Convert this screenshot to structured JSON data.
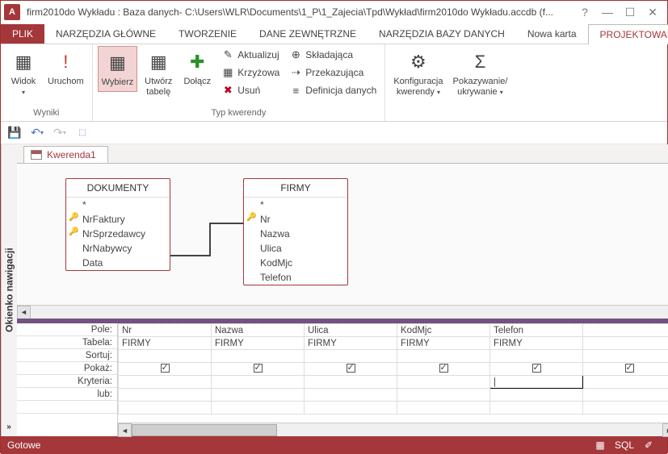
{
  "app": {
    "letter": "A",
    "title": "firm2010do Wykładu : Baza danych- C:\\Users\\WLR\\Documents\\1_P\\1_Zajecia\\Tpd\\Wykład\\firm2010do Wykładu.accdb (f..."
  },
  "tabs": {
    "plik": "PLIK",
    "narzedzia_glowne": "NARZĘDZIA GŁÓWNE",
    "tworzenie": "TWORZENIE",
    "dane_zew": "DANE ZEWNĘTRZNE",
    "narzedzia_bazy": "NARZĘDZIA BAZY DANYCH",
    "nowa_karta": "Nowa karta",
    "projekt": "PROJEKTOWANI"
  },
  "ribbon": {
    "wyniki": {
      "widok": "Widok",
      "uruchom": "Uruchom",
      "group": "Wyniki"
    },
    "typ": {
      "wybierz": "Wybierz",
      "utworz": "Utwórz\ntabelę",
      "dolacz": "Dołącz",
      "aktualizuj": "Aktualizuj",
      "krzyzowa": "Krzyżowa",
      "usun": "Usuń",
      "skladajaca": "Składająca",
      "przekazujaca": "Przekazująca",
      "definicja": "Definicja danych",
      "group": "Typ kwerendy"
    },
    "konfig": {
      "label": "Konfiguracja\nkwerendy",
      "pokaz": "Pokazywanie/\nukrywanie"
    }
  },
  "nav_label": "Okienko nawigacji",
  "query_tab": "Kwerenda1",
  "tables": {
    "dokumenty": {
      "title": "DOKUMENTY",
      "star": "*",
      "fields": [
        "NrFaktury",
        "NrSprzedawcy",
        "NrNabywcy",
        "Data"
      ],
      "keys": [
        true,
        true,
        false,
        false
      ]
    },
    "firmy": {
      "title": "FIRMY",
      "star": "*",
      "fields": [
        "Nr",
        "Nazwa",
        "Ulica",
        "KodMjc",
        "Telefon"
      ],
      "keys": [
        true,
        false,
        false,
        false,
        false
      ]
    }
  },
  "grid": {
    "rows": [
      "Pole:",
      "Tabela:",
      "Sortuj:",
      "Pokaż:",
      "Kryteria:",
      "lub:"
    ],
    "cols": [
      {
        "pole": "Nr",
        "tabela": "FIRMY",
        "pokaz": true
      },
      {
        "pole": "Nazwa",
        "tabela": "FIRMY",
        "pokaz": true
      },
      {
        "pole": "Ulica",
        "tabela": "FIRMY",
        "pokaz": true
      },
      {
        "pole": "KodMjc",
        "tabela": "FIRMY",
        "pokaz": true
      },
      {
        "pole": "Telefon",
        "tabela": "FIRMY",
        "pokaz": true
      },
      {
        "pole": "",
        "tabela": "",
        "pokaz": true
      }
    ]
  },
  "status": "Gotowe",
  "sql_label": "SQL"
}
